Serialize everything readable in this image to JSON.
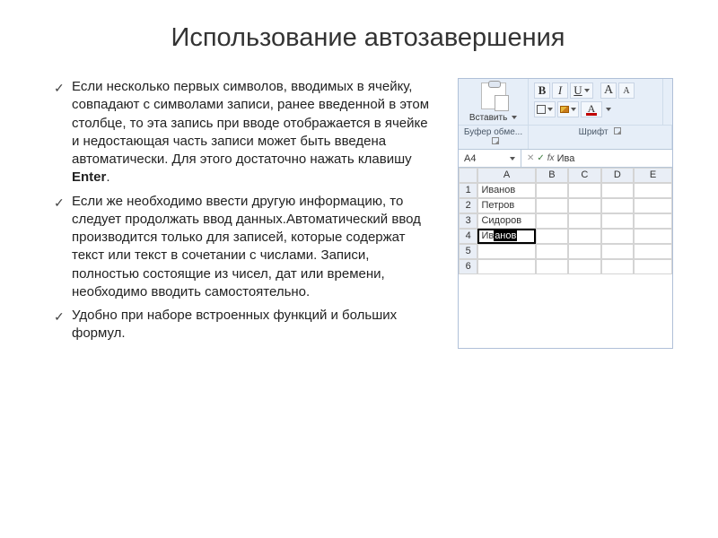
{
  "title": "Использование автозавершения",
  "bullets": [
    {
      "pre": "Если несколько первых символов, вводимых в ячейку, совпадают с символами записи, ранее введенной в этом столбце, то эта запись при вводе отображается в ячейке и недостающая часть записи может быть введена автоматически. Для этого достаточно нажать клавишу ",
      "bold": "Enter",
      "post": "."
    },
    {
      "pre": "Если же необходимо ввести другую информацию, то следует продолжать ввод данных.Автоматический ввод производится только для записей, которые содержат текст или текст в сочетании с числами. Записи, полностью состоящие из чисел, дат или времени, необходимо вводить самостоятельно.",
      "bold": "",
      "post": ""
    },
    {
      "pre": "Удобно при наборе встроенных функций и больших формул.",
      "bold": "",
      "post": ""
    }
  ],
  "excel": {
    "paste_label": "Вставить",
    "group_clipboard": "Буфер обме...",
    "group_font": "Шрифт",
    "btn_bold": "В",
    "btn_italic": "I",
    "btn_underline": "U",
    "btn_a_big": "A",
    "btn_a_small": "A",
    "font_color_a": "A",
    "namebox": "A4",
    "fx_label": "fx",
    "formula_value": "Ива",
    "columns": [
      "",
      "A",
      "B",
      "C",
      "D",
      "E"
    ],
    "rows": [
      {
        "n": "1",
        "a": "Иванов"
      },
      {
        "n": "2",
        "a": "Петров"
      },
      {
        "n": "3",
        "a": "Сидоров"
      },
      {
        "n": "4",
        "a_typed": "Ив",
        "a_suggest": "анов"
      },
      {
        "n": "5",
        "a": ""
      },
      {
        "n": "6",
        "a": ""
      }
    ]
  }
}
